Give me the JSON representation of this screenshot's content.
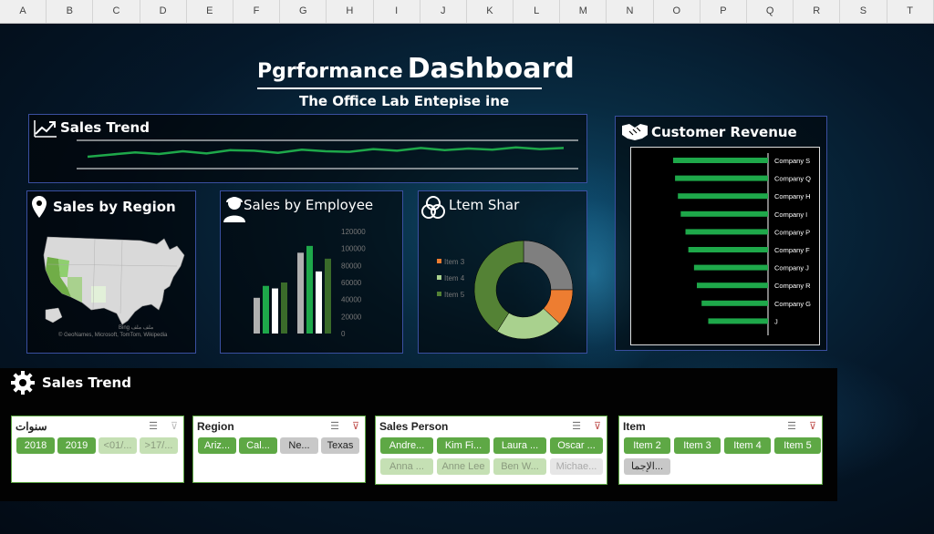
{
  "columns": [
    "A",
    "B",
    "C",
    "D",
    "E",
    "F",
    "G",
    "H",
    "I",
    "J",
    "K",
    "L",
    "M",
    "N",
    "O",
    "P",
    "Q",
    "R",
    "S",
    "T"
  ],
  "header": {
    "title_part1": "Pgrformance",
    "title_part2": "Dashboard",
    "subtitle": "The Office Lab Entepise ine"
  },
  "panels": {
    "sales_trend_top": {
      "title": "Sales Trend"
    },
    "sales_by_region": {
      "title": "Sales by Region",
      "map_credit1": "Bing ملف ملف",
      "map_credit2": "© GeoNames, Microsoft, TomTom, Wikipedia"
    },
    "sales_by_employee": {
      "title": "Sales by Employee"
    },
    "item_share": {
      "title": "Ltem Shar"
    },
    "customer_revenue": {
      "title": "Customer Revenue"
    },
    "sales_trend_bottom": {
      "title": "Sales Trend"
    }
  },
  "chart_data": [
    {
      "type": "line",
      "name": "sales-trend",
      "y": [
        2,
        2.4,
        2.8,
        2.5,
        3.0,
        2.6,
        3.2,
        3.1,
        2.7,
        3.3,
        3.0,
        2.9,
        3.4,
        3.1,
        3.6,
        3.2,
        3.5,
        3.3,
        3.7,
        3.4,
        3.6
      ],
      "ylim": [
        0,
        10
      ],
      "color": "#1ea84a"
    },
    {
      "type": "bar",
      "name": "sales-by-employee",
      "yticks": [
        "120000",
        "100000",
        "80000",
        "60000",
        "40000",
        "20000",
        "0"
      ],
      "ylim": [
        0,
        120000
      ],
      "groups": [
        {
          "values": [
            42000,
            56000,
            53000,
            60000
          ]
        },
        {
          "values": [
            95000,
            103000,
            73000,
            88000
          ]
        }
      ],
      "colors": [
        "#b0b0b0",
        "#1ea84a",
        "#ffffff",
        "#3a6b2a"
      ]
    },
    {
      "type": "pie",
      "name": "item-share",
      "legend": [
        "Item 3",
        "Item 4",
        "Item 5"
      ],
      "legend_colors": [
        "#ed7d31",
        "#a9d18e",
        "#548235"
      ],
      "slices": [
        {
          "value": 25,
          "color": "#7f7f7f"
        },
        {
          "value": 12,
          "color": "#ed7d31"
        },
        {
          "value": 22,
          "color": "#a9d18e"
        },
        {
          "value": 41,
          "color": "#548235"
        }
      ]
    },
    {
      "type": "bar",
      "name": "customer-revenue",
      "orientation": "horizontal",
      "categories": [
        "Company S",
        "Company Q",
        "Company H",
        "Company I",
        "Company P",
        "Company F",
        "Company J",
        "Company R",
        "Company G",
        "J"
      ],
      "values": [
        100,
        98,
        95,
        92,
        87,
        84,
        78,
        75,
        70,
        63
      ],
      "xlim": [
        0,
        100
      ],
      "color": "#1ea84a"
    }
  ],
  "slicers": [
    {
      "title": "سنوات",
      "items": [
        {
          "label": "2018",
          "state": "on"
        },
        {
          "label": "2019",
          "state": "on"
        },
        {
          "label": "<01/...",
          "state": "pale"
        },
        {
          "label": ">17/...",
          "state": "pale"
        }
      ]
    },
    {
      "title": "Region",
      "items": [
        {
          "label": "Ariz...",
          "state": "on"
        },
        {
          "label": "Cal...",
          "state": "on"
        },
        {
          "label": "Ne...",
          "state": "gray"
        },
        {
          "label": "Texas",
          "state": "gray"
        }
      ]
    },
    {
      "title": "Sales Person",
      "items": [
        {
          "label": "Andre...",
          "state": "on"
        },
        {
          "label": "Kim Fi...",
          "state": "on"
        },
        {
          "label": "Laura ...",
          "state": "on"
        },
        {
          "label": "Oscar ...",
          "state": "on"
        },
        {
          "label": "Anna ...",
          "state": "pale"
        },
        {
          "label": "Anne Lee",
          "state": "pale"
        },
        {
          "label": "Ben W...",
          "state": "pale"
        },
        {
          "label": "Michae...",
          "state": "ghost"
        }
      ]
    },
    {
      "title": "Item",
      "items": [
        {
          "label": "Item 2",
          "state": "on"
        },
        {
          "label": "Item 3",
          "state": "on"
        },
        {
          "label": "Item 4",
          "state": "on"
        },
        {
          "label": "Item 5",
          "state": "on"
        },
        {
          "label": "الإجما...",
          "state": "gray"
        }
      ]
    }
  ]
}
